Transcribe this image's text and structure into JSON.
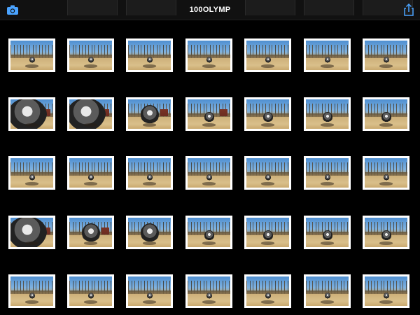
{
  "toolbar": {
    "title": "100OLYMP",
    "camera_icon": "camera-icon",
    "share_icon": "share-icon",
    "accent_color": "#4aa3ff"
  },
  "grid": {
    "rows": 5,
    "columns": 7,
    "photos": [
      [
        "far",
        "far",
        "far",
        "far",
        "far",
        "far",
        "far"
      ],
      [
        "huge",
        "huge",
        "near",
        "mid",
        "mid",
        "mid",
        "mid"
      ],
      [
        "far",
        "far",
        "far",
        "far",
        "far",
        "far",
        "far"
      ],
      [
        "huge",
        "near",
        "near",
        "mid",
        "mid",
        "mid",
        "mid"
      ],
      [
        "far",
        "far",
        "far",
        "far",
        "far",
        "far",
        "far"
      ]
    ]
  }
}
